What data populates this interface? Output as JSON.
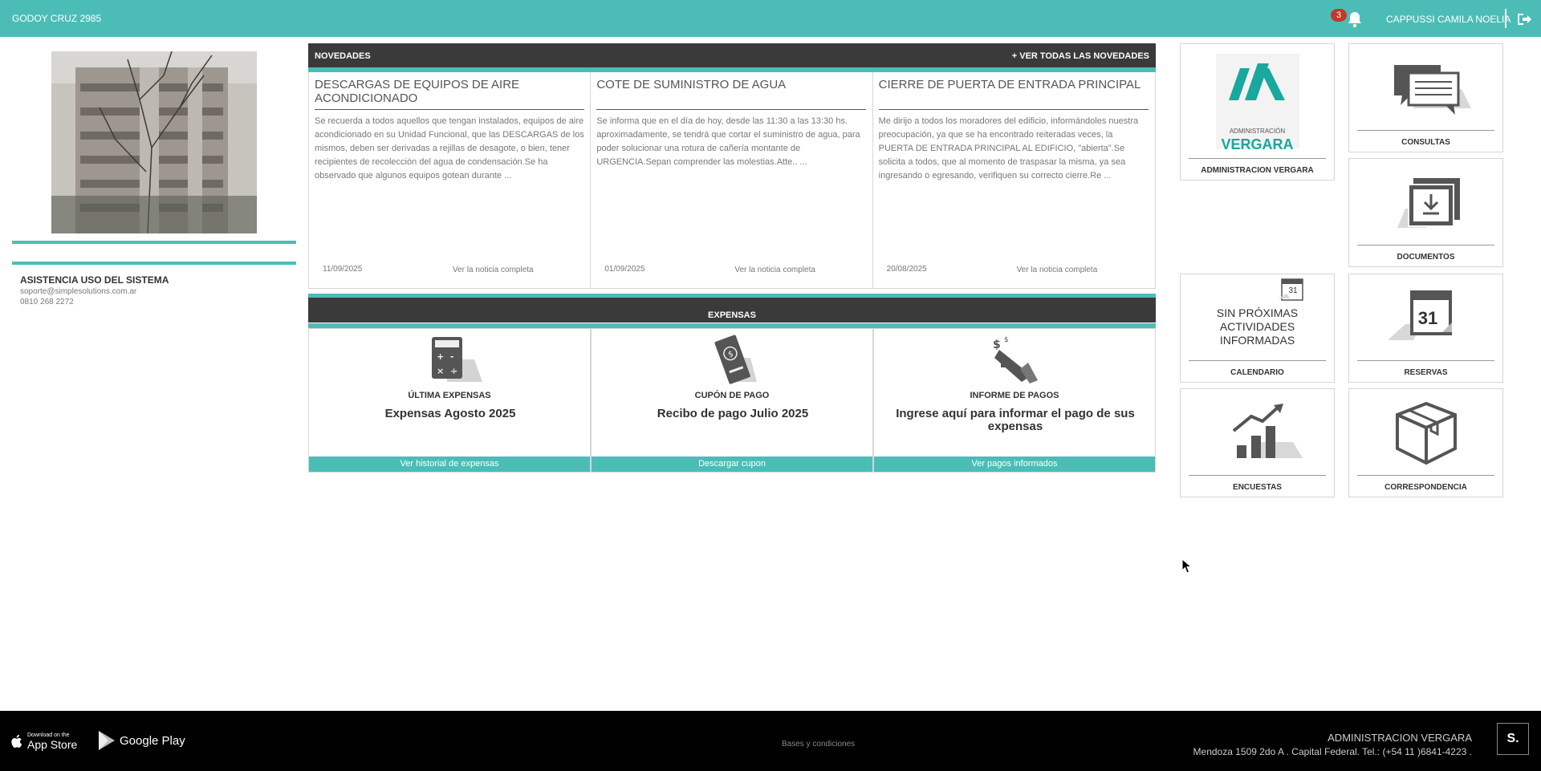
{
  "topbar": {
    "building_name": "GODOY CRUZ 2985",
    "notification_count": "3",
    "user_name": "CAPPUSSI CAMILA NOELIA"
  },
  "support": {
    "title": "ASISTENCIA USO DEL SISTEMA",
    "email": "soporte@simplesolutions.com.ar",
    "phone": "0810 268 2272"
  },
  "novedades": {
    "header": "NOVEDADES",
    "view_all": "+ VER TODAS LAS NOVEDADES",
    "items": [
      {
        "title": "DESCARGAS DE EQUIPOS DE AIRE ACONDICIONADO",
        "body": "Se recuerda a todos aquellos que tengan instalados, equipos de aire acondicionado en su  Unidad Funcional, que las DESCARGAS de los mismos, deben ser derivadas a rejillas de desagote, o bien, tener recipientes de recolección del agua de condensación.Se ha observado que algunos equipos gotean durante ...",
        "date": "11/09/2025",
        "link": "Ver la noticia completa"
      },
      {
        "title": "COTE DE SUMINISTRO DE AGUA",
        "body": "Se informa que en el día de hoy, desde las 11:30 a las 13:30 hs. aproximadamente, se tendrá que cortar el suministro de agua, para poder solucionar una rotura de cañería montante de URGENCIA.Sepan comprender las molestias.Atte.. ...",
        "date": "01/09/2025",
        "link": "Ver la noticia completa"
      },
      {
        "title": "CIERRE DE PUERTA DE ENTRADA PRINCIPAL",
        "body": "Me dirijo a todos los moradores del edificio, informándoles nuestra preocupación, ya que se ha encontrado reiteradas veces, la PUERTA DE ENTRADA PRINCIPAL AL EDIFICIO, \"abierta\".Se solicita a todos, que al momento de traspasar la misma, ya sea ingresando o egresando, verifiquen su correcto cierre.Re ...",
        "date": "20/08/2025",
        "link": "Ver la noticia completa"
      }
    ]
  },
  "expensas": {
    "header": "EXPENSAS",
    "cards": [
      {
        "label": "ÚLTIMA EXPENSAS",
        "value": "Expensas Agosto 2025",
        "button": "Ver historial de expensas"
      },
      {
        "label": "CUPÓN DE PAGO",
        "value": "Recibo de pago Julio 2025",
        "button": "Descargar cupon"
      },
      {
        "label": "INFORME DE PAGOS",
        "value": "Ingrese aquí para informar el pago de sus expensas",
        "button": "Ver pagos informados"
      }
    ]
  },
  "tiles": {
    "admin": {
      "label": "ADMINISTRACION VERGARA",
      "logo_small": "ADMINISTRACIÓN",
      "logo_big": "VERGARA"
    },
    "consultas": {
      "label": "CONSULTAS"
    },
    "documentos": {
      "label": "DOCUMENTOS"
    },
    "calendario": {
      "label": "CALENDARIO",
      "empty_text": "SIN PRÓXIMAS ACTIVIDADES INFORMADAS",
      "icon_day": "31"
    },
    "reservas": {
      "label": "RESERVAS",
      "icon_day": "31"
    },
    "encuestas": {
      "label": "ENCUESTAS"
    },
    "correspondencia": {
      "label": "CORRESPONDENCIA"
    }
  },
  "footer": {
    "appstore_small": "Download on the",
    "appstore_big": "App Store",
    "googleplay": "Google Play",
    "bases": "Bases y condiciones",
    "admin_name": "ADMINISTRACION VERGARA",
    "admin_address": "Mendoza 1509 2do A . Capital Federal. Tel.: (+54 11 )6841-4223 .",
    "logo": "S."
  },
  "colors": {
    "teal": "#4bbdb6",
    "dark": "#3a3a3a",
    "badge_red": "#c0392b",
    "footer": "#000000"
  },
  "icons": [
    "bell-icon",
    "logout-icon",
    "calculator-icon",
    "coupon-icon",
    "megaphone-icon",
    "chat-icon",
    "folder-download-icon",
    "calendar-icon",
    "chart-up-icon",
    "box-icon",
    "apple-icon",
    "google-play-icon"
  ]
}
